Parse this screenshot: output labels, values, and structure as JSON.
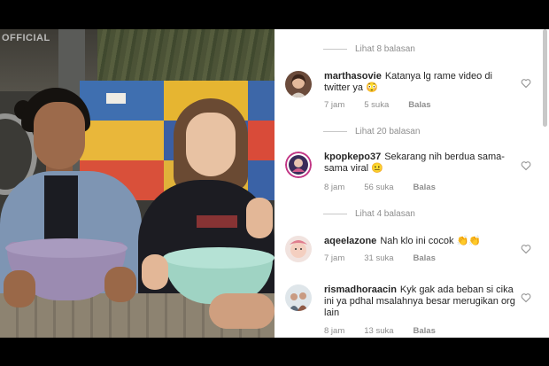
{
  "video": {
    "watermark": "OFFICIAL"
  },
  "comments": [
    {
      "view_replies": "Lihat 8 balasan",
      "username": "marthasovie",
      "text": "Katanya lg rame video di twitter ya",
      "emoji": "😳",
      "time": "7 jam",
      "likes": "5 suka",
      "reply": "Balas",
      "avatar_icon": "avatar-woman-icon"
    },
    {
      "view_replies": "Lihat 20 balasan",
      "username": "kpopkepo37",
      "text": "Sekarang nih berdua sama-sama viral",
      "emoji": "😐",
      "time": "8 jam",
      "likes": "56 suka",
      "reply": "Balas",
      "avatar_icon": "avatar-story-ring-icon"
    },
    {
      "view_replies": "Lihat 4 balasan",
      "username": "aqeelazone",
      "text": "Nah klo ini cocok",
      "emoji": "👏👏",
      "time": "7 jam",
      "likes": "31 suka",
      "reply": "Balas",
      "avatar_icon": "avatar-baby-icon"
    },
    {
      "username": "rismadhoraacin",
      "text": "Kyk gak ada beban si cika ini ya pdhal msalahnya besar merugikan org lain",
      "time": "8 jam",
      "likes": "13 suka",
      "reply": "Balas",
      "avatar_icon": "avatar-group-icon"
    }
  ],
  "colors": {
    "text": "#262626",
    "meta": "#8e8e8e",
    "heart_outline": "#8e8e8e",
    "story_ring": "#c13584"
  }
}
